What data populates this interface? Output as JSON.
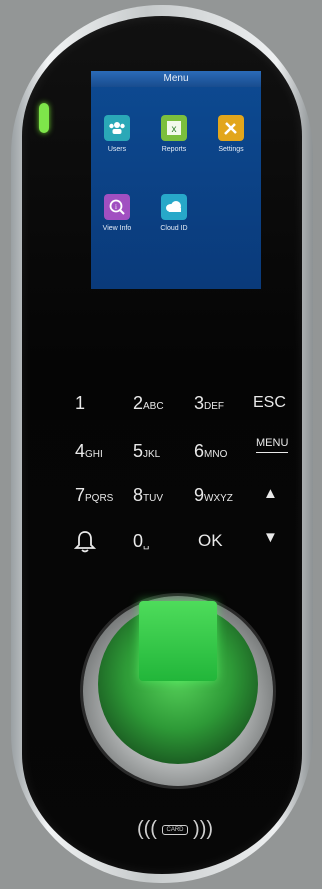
{
  "screen": {
    "title": "Menu",
    "items": [
      {
        "label": "Users",
        "icon": "users-icon",
        "color": "#2aa8b7"
      },
      {
        "label": "Reports",
        "icon": "excel-icon",
        "color": "#7bbf3d"
      },
      {
        "label": "Settings",
        "icon": "tools-icon",
        "color": "#e2a61c"
      },
      {
        "label": "View Info",
        "icon": "magnify-info-icon",
        "color": "#a14fc1"
      },
      {
        "label": "Cloud ID",
        "icon": "cloud-icon",
        "color": "#27a8c9"
      }
    ]
  },
  "keypad": {
    "k1": {
      "main": "1",
      "sub": ""
    },
    "k2": {
      "main": "2",
      "sub": "ABC"
    },
    "k3": {
      "main": "3",
      "sub": "DEF"
    },
    "esc": {
      "main": "ESC"
    },
    "k4": {
      "main": "4",
      "sub": "GHI"
    },
    "k5": {
      "main": "5",
      "sub": "JKL"
    },
    "k6": {
      "main": "6",
      "sub": "MNO"
    },
    "menu": {
      "main": "MENU"
    },
    "k7": {
      "main": "7",
      "sub": "PQRS"
    },
    "k8": {
      "main": "8",
      "sub": "TUV"
    },
    "k9": {
      "main": "9",
      "sub": "WXYZ"
    },
    "up": {
      "main": "▲"
    },
    "bell": {
      "main": "🔔"
    },
    "k0": {
      "main": "0",
      "sub": "␣"
    },
    "ok": {
      "main": "OK"
    },
    "down": {
      "main": "▼"
    }
  },
  "card_reader": {
    "label": "CARD"
  }
}
